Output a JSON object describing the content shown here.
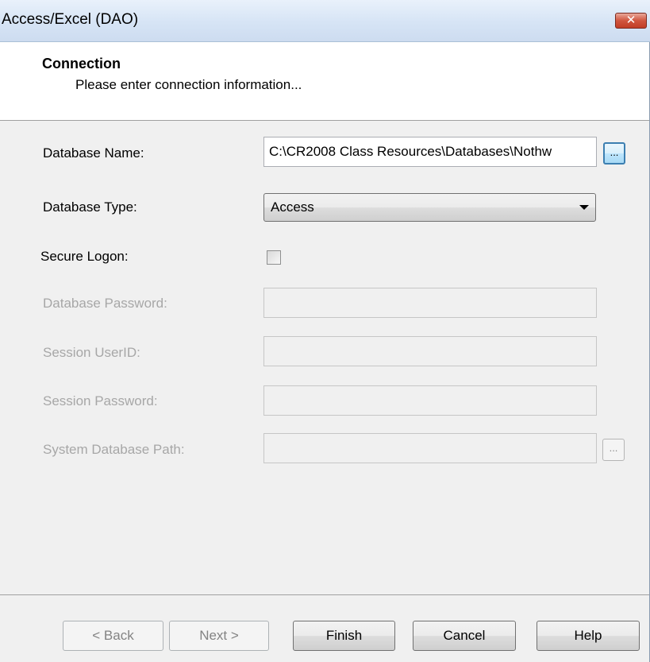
{
  "window": {
    "title": "Access/Excel (DAO)",
    "close_label": "✕"
  },
  "header": {
    "title": "Connection",
    "subtitle": "Please enter connection information..."
  },
  "form": {
    "database_name": {
      "label": "Database Name:",
      "value": "C:\\CR2008 Class Resources\\Databases\\Nothw",
      "browse_label": "..."
    },
    "database_type": {
      "label": "Database Type:",
      "value": "Access"
    },
    "secure_logon": {
      "label": "Secure Logon:",
      "checked": false
    },
    "database_password": {
      "label": "Database Password:",
      "value": ""
    },
    "session_userid": {
      "label": "Session UserID:",
      "value": ""
    },
    "session_password": {
      "label": "Session Password:",
      "value": ""
    },
    "system_database_path": {
      "label": "System Database Path:",
      "value": "",
      "browse_label": "..."
    }
  },
  "buttons": {
    "back": "< Back",
    "next": "Next >",
    "finish": "Finish",
    "cancel": "Cancel",
    "help": "Help"
  },
  "colors": {
    "disabled_text": "#a7a7a7",
    "focus_border": "#3c7fb1",
    "close_red": "#c13d25"
  }
}
